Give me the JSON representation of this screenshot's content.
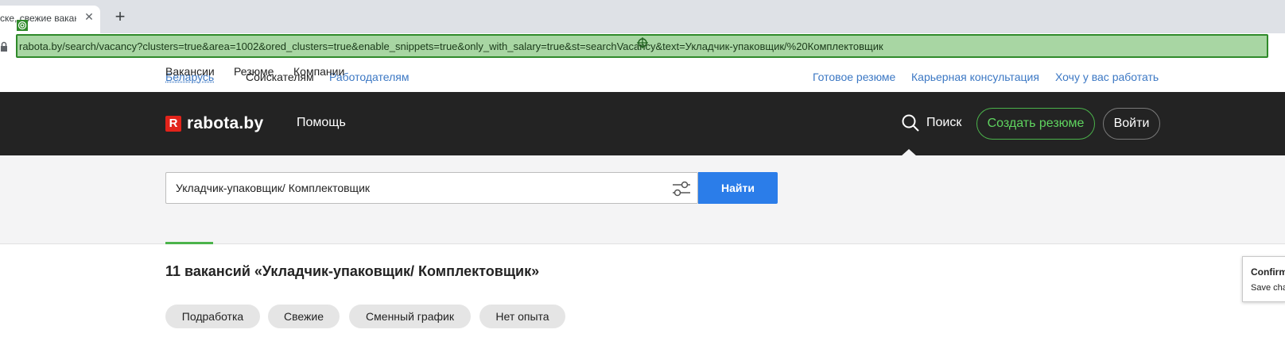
{
  "browser": {
    "tab_title": "ске, свежие ваканс",
    "close_glyph": "✕",
    "newtab_glyph": "+",
    "url": "rabota.by/search/vacancy?clusters=true&area=1002&ored_clusters=true&enable_snippets=true&only_with_salary=true&st=searchVacancy&text=Укладчик-упаковщик/%20Комплектовщик",
    "star_glyph": "☆",
    "accent": "#2f8a2a"
  },
  "topnav": {
    "region": "Беларусь",
    "seekers": "Соискателям",
    "employers": "Работодателям",
    "ready_resume": "Готовое резюме",
    "career": "Карьерная консультация",
    "work_with_us": "Хочу у вас работать"
  },
  "header": {
    "logo_mark": "R",
    "logo_text": "rabota.by",
    "help": "Помощь",
    "search": "Поиск",
    "create_resume": "Создать резюме",
    "login": "Войти"
  },
  "search": {
    "query": "Укладчик-упаковщик/ Комплектовщик",
    "find_button": "Найти",
    "tabs": [
      "Вакансии",
      "Резюме",
      "Компании"
    ]
  },
  "results": {
    "title": "11 вакансий «Укладчик-упаковщик/ Комплектовщик»",
    "chips": [
      "Подработка",
      "Свежие",
      "Сменный график",
      "Нет опыта"
    ]
  },
  "confirm_popup": {
    "title": "Confirm",
    "subtitle": "Save cha"
  },
  "colors": {
    "header_bg": "#232323",
    "search_blue": "#2b7de9",
    "green": "#4bb34b",
    "link_blue": "#3c78c4"
  }
}
